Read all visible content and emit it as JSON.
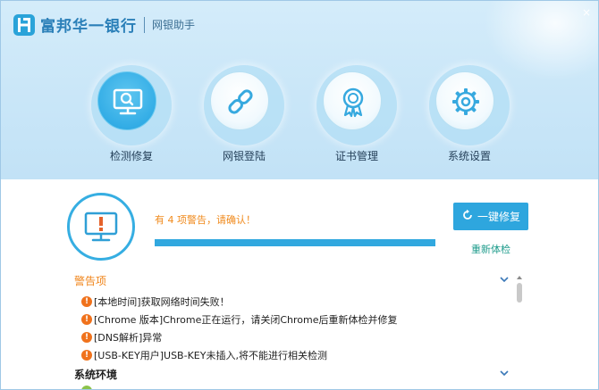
{
  "header": {
    "brand_name": "富邦华一银行",
    "product_name": "网银助手",
    "close_glyph": "×"
  },
  "nav": {
    "items": [
      {
        "label": "检测修复",
        "icon": "monitor-search-icon",
        "active": true
      },
      {
        "label": "网银登陆",
        "icon": "link-icon",
        "active": false
      },
      {
        "label": "证书管理",
        "icon": "certificate-badge-icon",
        "active": false
      },
      {
        "label": "系统设置",
        "icon": "gear-icon",
        "active": false
      }
    ]
  },
  "status": {
    "message": "有 4 项警告，请确认！",
    "progress_fraction": 1.0,
    "repair_button_label": "一键修复",
    "recheck_label": "重新体检"
  },
  "warnings": {
    "heading": "警告项",
    "dot_glyph": "!",
    "items": [
      "[本地时间]获取网络时间失败！",
      "[Chrome 版本]Chrome正在运行，请关闭Chrome后重新体检并修复",
      "[DNS解析]异常",
      "[USB-KEY用户]USB-KEY未插入,将不能进行相关检测"
    ]
  },
  "system_env": {
    "heading": "系统环境"
  },
  "colors": {
    "accent": "#2ea6de",
    "warning": "#f0851b",
    "link": "#1f9c8c"
  }
}
